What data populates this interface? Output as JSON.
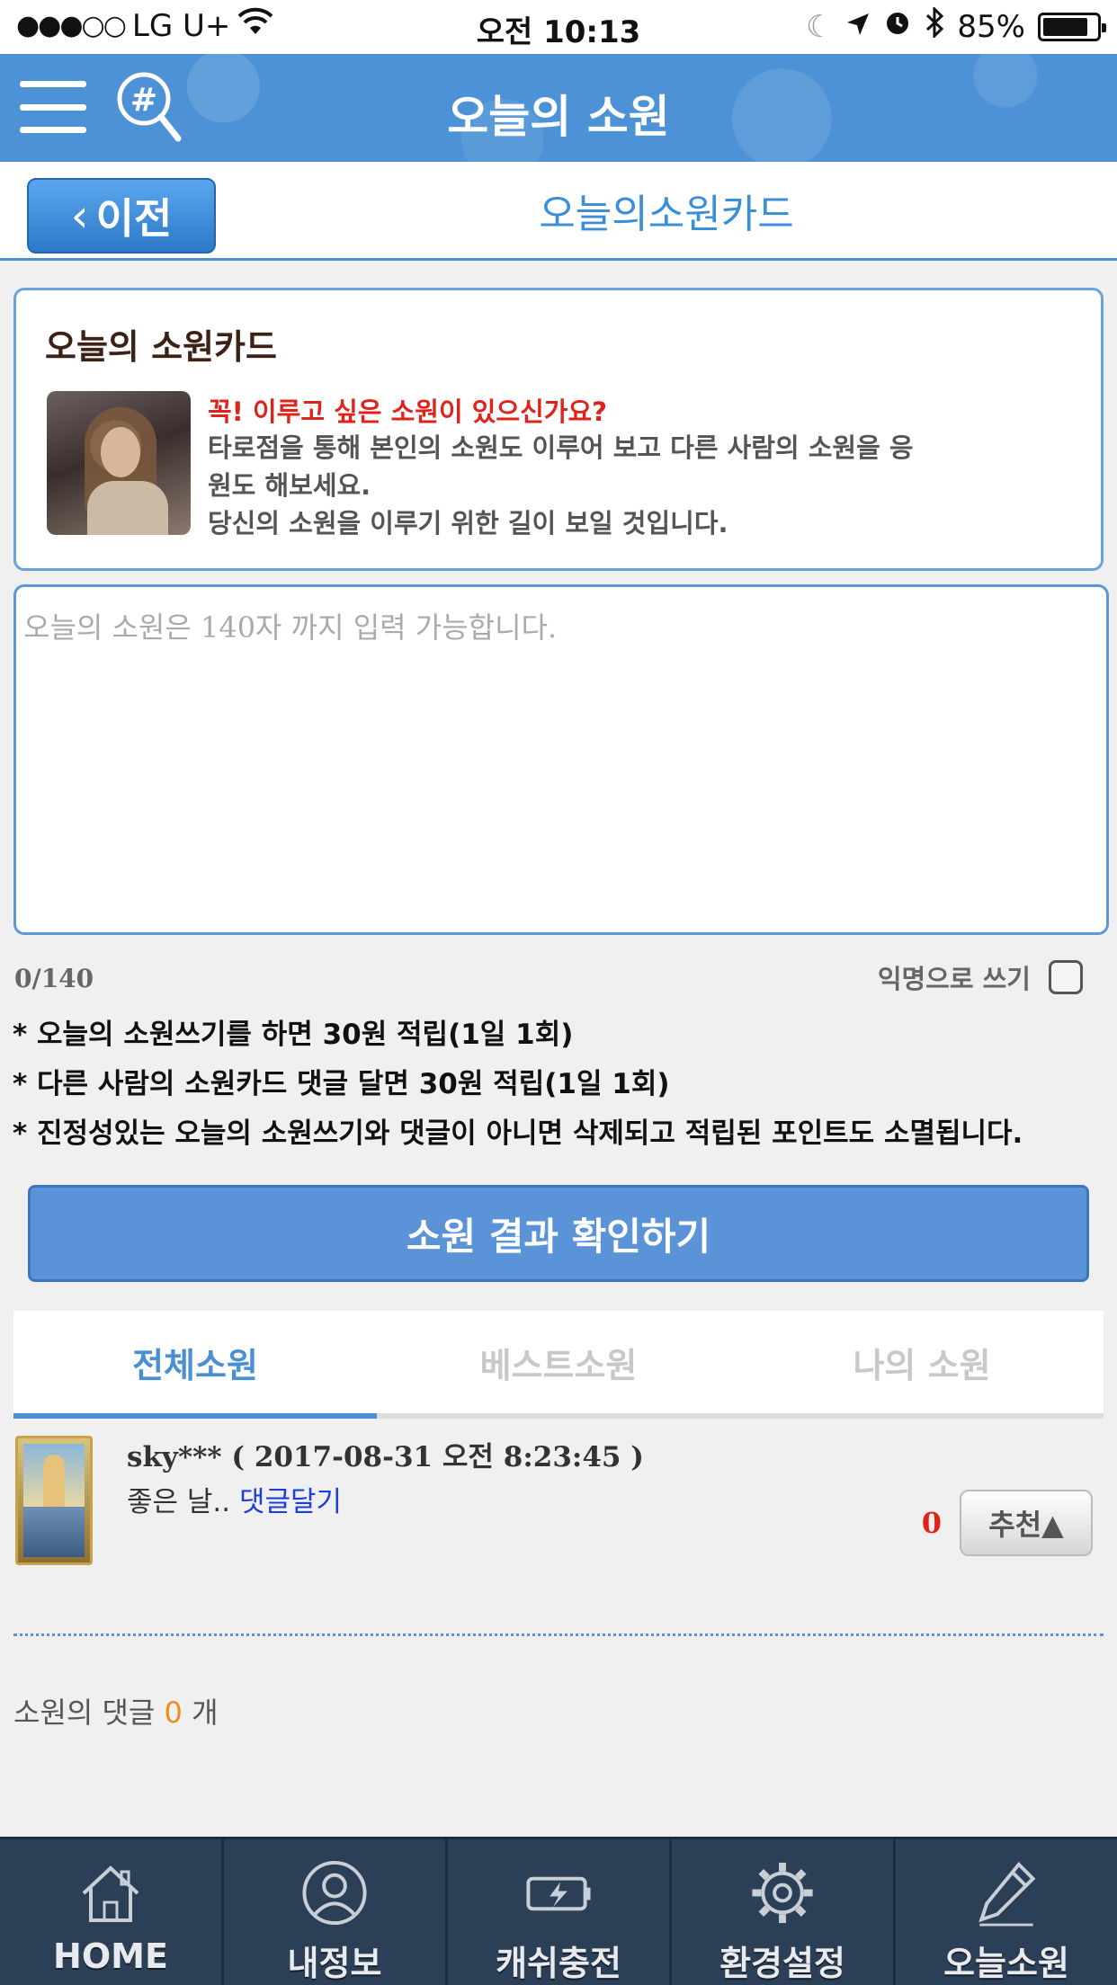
{
  "status_bar": {
    "signal": "●●●○○",
    "carrier": "LG U+",
    "time": "오전 10:13",
    "battery": "85%"
  },
  "header": {
    "title": "오늘의 소원"
  },
  "subheader": {
    "back_label": "이전",
    "title": "오늘의소원카드"
  },
  "intro": {
    "title": "오늘의 소원카드",
    "lead": "꼭! 이루고 싶은 소원이 있으신가요?",
    "desc_line1": "타로점을 통해 본인의 소원도 이루어 보고 다른 사람의 소원을 응",
    "desc_line2": "원도 해보세요.",
    "desc_line3": "당신의 소원을 이루기 위한 길이 보일 것입니다."
  },
  "wish_input": {
    "placeholder": "오늘의 소원은 140자 까지 입력 가능합니다.",
    "value": ""
  },
  "counter": "0/140",
  "anonymous_label": "익명으로 쓰기",
  "notes": [
    "* 오늘의 소원쓰기를 하면 30원 적립(1일 1회)",
    "* 다른 사람의 소원카드 댓글 달면 30원 적립(1일 1회)",
    "* 진정성있는 오늘의 소원쓰기와 댓글이 아니면 삭제되고 적립된 포인트도 소멸됩니다."
  ],
  "confirm_button": "소원 결과 확인하기",
  "tabs": [
    {
      "label": "전체소원",
      "active": true
    },
    {
      "label": "베스트소원",
      "active": false
    },
    {
      "label": "나의 소원",
      "active": false
    }
  ],
  "wish_item": {
    "meta": "sky*** ( 2017-08-31 오전 8:23:45 )",
    "text": "좋은 날..",
    "reply_link": "댓글달기",
    "count": "0",
    "recommend_label": "추천▲"
  },
  "comments": {
    "prefix": "소원의 댓글",
    "count": "0",
    "suffix": "개"
  },
  "bottom_nav": [
    {
      "label": "HOME",
      "icon": "home-icon"
    },
    {
      "label": "내정보",
      "icon": "user-icon"
    },
    {
      "label": "캐쉬충전",
      "icon": "battery-charge-icon"
    },
    {
      "label": "환경설정",
      "icon": "gear-icon"
    },
    {
      "label": "오늘소원",
      "icon": "pencil-icon"
    }
  ],
  "colors": {
    "primary": "#4a8fd4",
    "header_bg": "#4d92d6",
    "accent_red": "#e0231a",
    "nav_bg": "#2b3f57",
    "comment_count": "#f08a18"
  }
}
